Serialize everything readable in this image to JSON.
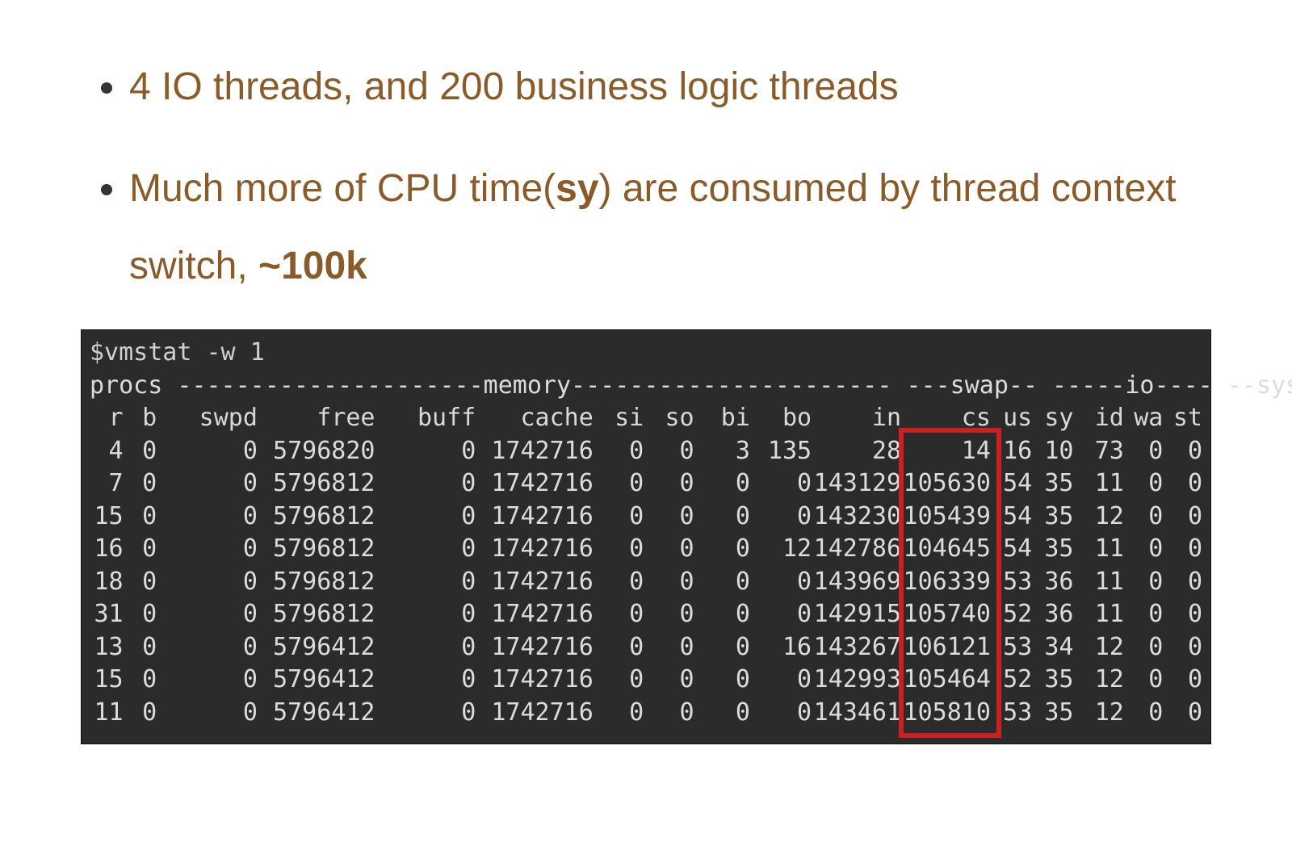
{
  "bullets": {
    "items": [
      {
        "pre": "4 IO threads, and 200 business logic threads",
        "bold1": "",
        "mid": "",
        "bold2": ""
      },
      {
        "pre": "Much more of CPU time(",
        "bold1": "sy",
        "mid": ") are consumed by thread context switch, ",
        "bold2": "~100k"
      }
    ]
  },
  "terminal": {
    "command": "$vmstat -w 1",
    "section_line": "procs ---------------------memory---------------------- ---swap-- -----io---- --system-- -----cpu-------",
    "headers": [
      "r",
      "b",
      "swpd",
      "free",
      "buff",
      "cache",
      "si",
      "so",
      "bi",
      "bo",
      "in",
      "cs",
      "us",
      "sy",
      "id",
      "wa",
      "st"
    ],
    "rows": [
      {
        "r": 4,
        "b": 0,
        "swpd": 0,
        "free": 5796820,
        "buff": 0,
        "cache": 1742716,
        "si": 0,
        "so": 0,
        "bi": 3,
        "bo": 135,
        "in": 28,
        "cs": 14,
        "us": 16,
        "sy": 10,
        "id": 73,
        "wa": 0,
        "st": 0
      },
      {
        "r": 7,
        "b": 0,
        "swpd": 0,
        "free": 5796812,
        "buff": 0,
        "cache": 1742716,
        "si": 0,
        "so": 0,
        "bi": 0,
        "bo": 0,
        "in": 143129,
        "cs": 105630,
        "us": 54,
        "sy": 35,
        "id": 11,
        "wa": 0,
        "st": 0
      },
      {
        "r": 15,
        "b": 0,
        "swpd": 0,
        "free": 5796812,
        "buff": 0,
        "cache": 1742716,
        "si": 0,
        "so": 0,
        "bi": 0,
        "bo": 0,
        "in": 143230,
        "cs": 105439,
        "us": 54,
        "sy": 35,
        "id": 12,
        "wa": 0,
        "st": 0
      },
      {
        "r": 16,
        "b": 0,
        "swpd": 0,
        "free": 5796812,
        "buff": 0,
        "cache": 1742716,
        "si": 0,
        "so": 0,
        "bi": 0,
        "bo": 12,
        "in": 142786,
        "cs": 104645,
        "us": 54,
        "sy": 35,
        "id": 11,
        "wa": 0,
        "st": 0
      },
      {
        "r": 18,
        "b": 0,
        "swpd": 0,
        "free": 5796812,
        "buff": 0,
        "cache": 1742716,
        "si": 0,
        "so": 0,
        "bi": 0,
        "bo": 0,
        "in": 143969,
        "cs": 106339,
        "us": 53,
        "sy": 36,
        "id": 11,
        "wa": 0,
        "st": 0
      },
      {
        "r": 31,
        "b": 0,
        "swpd": 0,
        "free": 5796812,
        "buff": 0,
        "cache": 1742716,
        "si": 0,
        "so": 0,
        "bi": 0,
        "bo": 0,
        "in": 142915,
        "cs": 105740,
        "us": 52,
        "sy": 36,
        "id": 11,
        "wa": 0,
        "st": 0
      },
      {
        "r": 13,
        "b": 0,
        "swpd": 0,
        "free": 5796412,
        "buff": 0,
        "cache": 1742716,
        "si": 0,
        "so": 0,
        "bi": 0,
        "bo": 16,
        "in": 143267,
        "cs": 106121,
        "us": 53,
        "sy": 34,
        "id": 12,
        "wa": 0,
        "st": 0
      },
      {
        "r": 15,
        "b": 0,
        "swpd": 0,
        "free": 5796412,
        "buff": 0,
        "cache": 1742716,
        "si": 0,
        "so": 0,
        "bi": 0,
        "bo": 0,
        "in": 142993,
        "cs": 105464,
        "us": 52,
        "sy": 35,
        "id": 12,
        "wa": 0,
        "st": 0
      },
      {
        "r": 11,
        "b": 0,
        "swpd": 0,
        "free": 5796412,
        "buff": 0,
        "cache": 1742716,
        "si": 0,
        "so": 0,
        "bi": 0,
        "bo": 0,
        "in": 143461,
        "cs": 105810,
        "us": 53,
        "sy": 35,
        "id": 12,
        "wa": 0,
        "st": 0
      }
    ],
    "highlight": {
      "column": "cs"
    }
  }
}
